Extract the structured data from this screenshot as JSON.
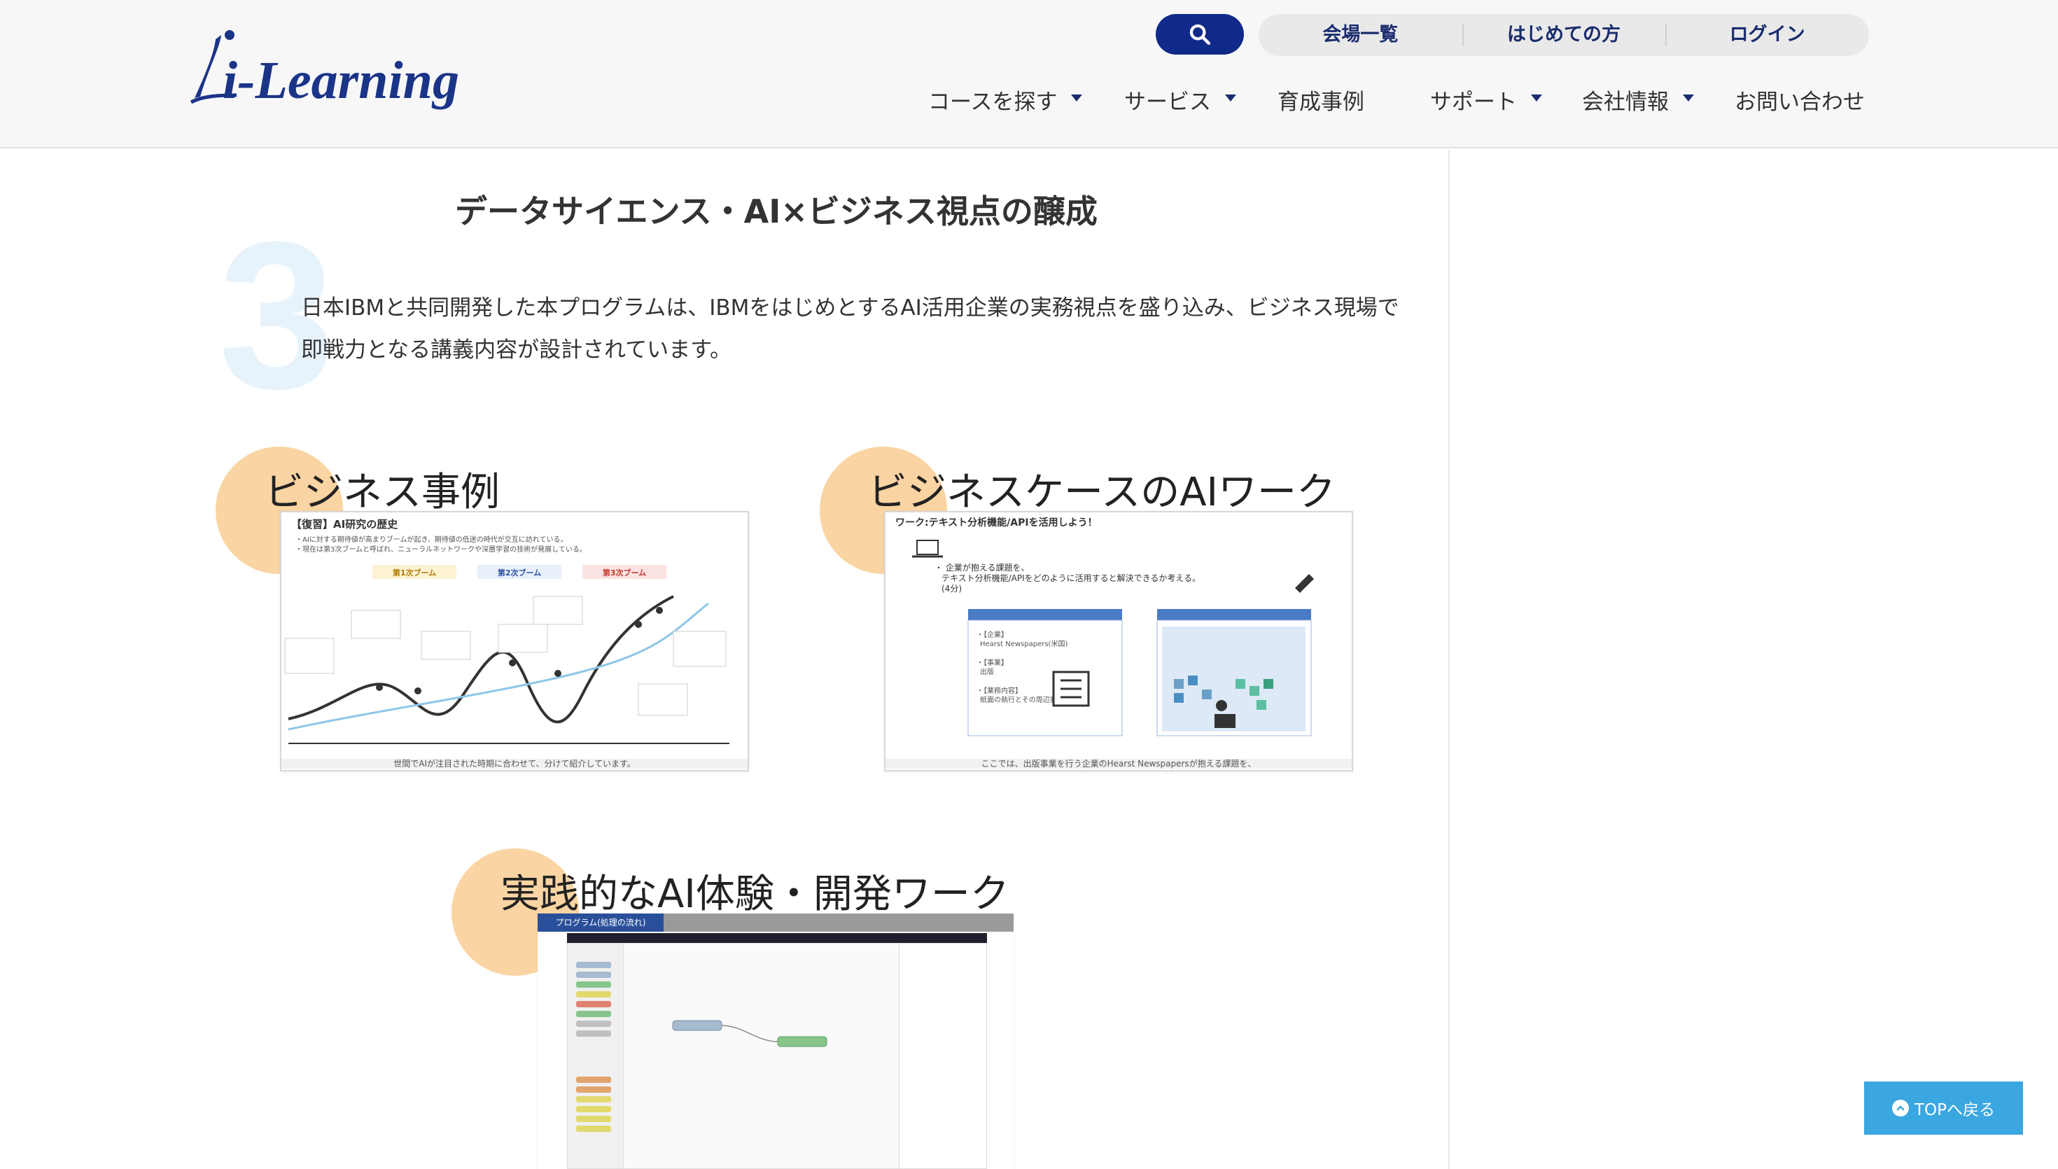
{
  "header": {
    "logo_text": "i-Learning",
    "top_links": [
      "会場一覧",
      "はじめての方",
      "ログイン"
    ],
    "nav": [
      {
        "label": "コースを探す",
        "dropdown": true
      },
      {
        "label": "サービス",
        "dropdown": true
      },
      {
        "label": "育成事例",
        "dropdown": false
      },
      {
        "label": "サポート",
        "dropdown": true
      },
      {
        "label": "会社情報",
        "dropdown": true
      },
      {
        "label": "お問い合わせ",
        "dropdown": false
      }
    ]
  },
  "section": {
    "number": "3",
    "title": "データサイエンス・AI×ビジネス視点の醸成",
    "description": "日本IBMと共同開発した本プログラムは、IBMをはじめとするAI活用企業の実務視点を盛り込み、ビジネス現場で即戦力となる講義内容が設計されています。"
  },
  "cards": [
    {
      "title": "ビジネス事例",
      "slide_heading": "【復習】AI研究の歴史",
      "slide_footer": "世間でAIが注目された時期に合わせて、分けて紹介しています。"
    },
    {
      "title": "ビジネスケースのAIワーク",
      "slide_heading": "ワーク:テキスト分析機能/APIを活用しよう！",
      "slide_footer": "ここでは、出版事業を行う企業のHearst Newspapersが抱える課題を、"
    },
    {
      "title": "実践的なAI体験・開発ワーク",
      "slide_heading": "プログラム(処理の流れ)",
      "slide_footer": ""
    }
  ],
  "back_to_top": "TOPへ戻る",
  "colors": {
    "brand_navy": "#102a8a",
    "accent_orange": "#fad4a2",
    "top_button": "#3aa7e0"
  }
}
